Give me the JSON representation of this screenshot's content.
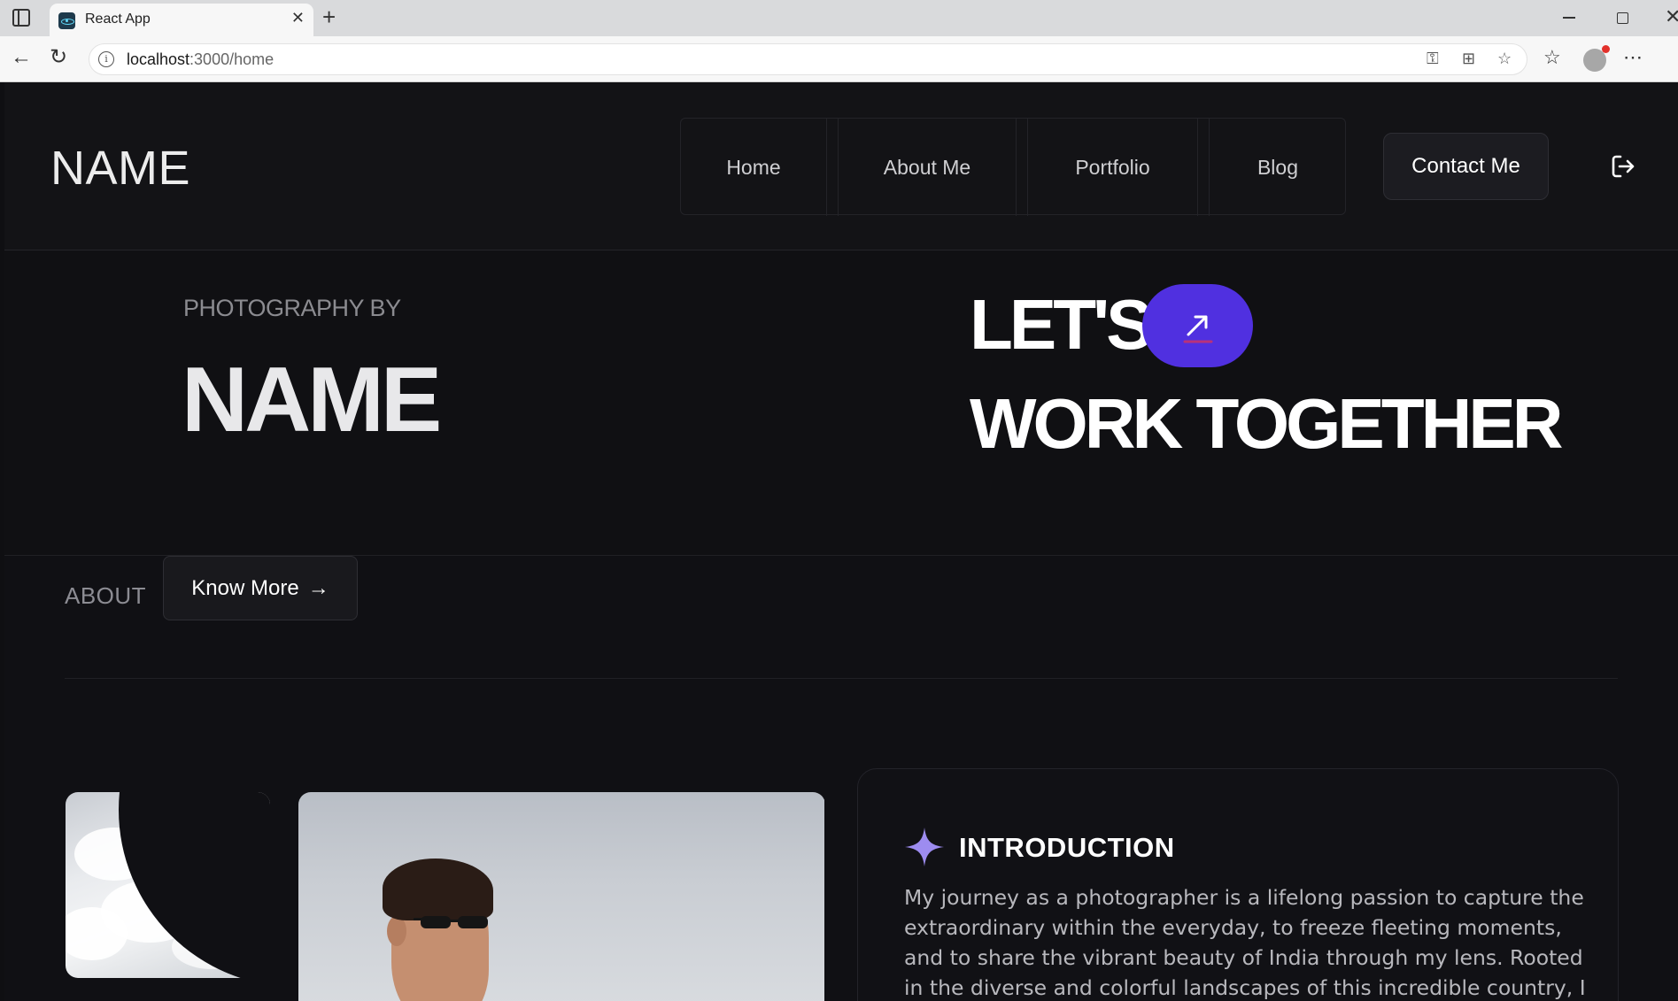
{
  "browser": {
    "tab_title": "React App",
    "tab_close": "✕",
    "new_tab": "+",
    "url_host": "localhost",
    "url_path": ":3000/home"
  },
  "header": {
    "logo": "NAME",
    "nav": [
      "Home",
      "About Me",
      "Portfolio",
      "Blog"
    ],
    "contact": "Contact Me"
  },
  "hero": {
    "kicker": "PHOTOGRAPHY BY",
    "name": "NAME",
    "lets": "LET'S",
    "together": "WORK TOGETHER",
    "accent_color": "#5030e0"
  },
  "about": {
    "label": "ABOUT",
    "button": "Know More",
    "button_arrow": "→"
  },
  "intro": {
    "title": "INTRODUCTION",
    "text": "My journey as a photographer is a lifelong passion to capture the extraordinary within the everyday, to freeze fleeting moments, and to share the vibrant beauty of India through my lens. Rooted in the diverse and colorful landscapes of this incredible country, I draw inspiration"
  },
  "icons": {
    "logout": "logout-icon",
    "sparkle": "sparkle-icon",
    "arrow": "arrow-up-right-icon"
  }
}
